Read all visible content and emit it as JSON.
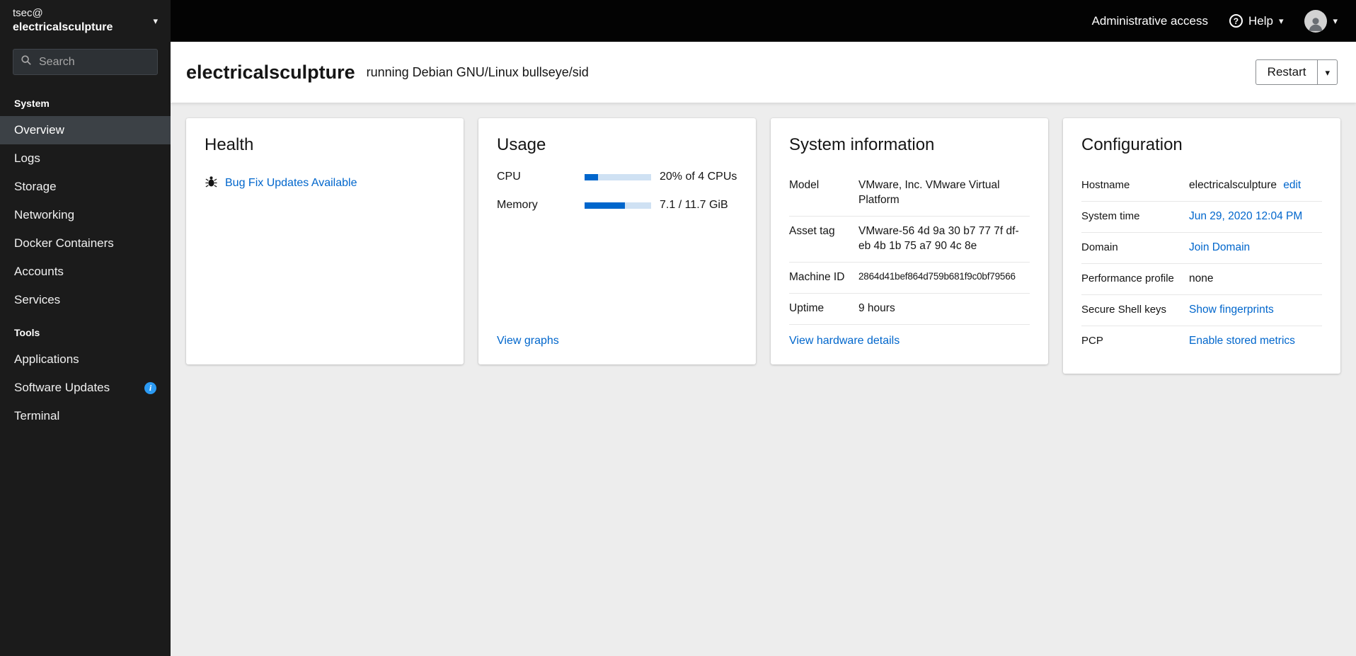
{
  "colors": {
    "accent": "#0066cc",
    "progress_fill": "#0066cc",
    "progress_track": "#cfe1f3",
    "info_badge": "#2b9af3"
  },
  "masthead": {
    "admin_access": "Administrative access",
    "help": "Help"
  },
  "sidebar": {
    "user": "tsec@",
    "host": "electricalsculpture",
    "search": {
      "placeholder": "Search"
    },
    "sections": [
      {
        "label": "System",
        "items": [
          {
            "label": "Overview",
            "active": true
          },
          {
            "label": "Logs"
          },
          {
            "label": "Storage"
          },
          {
            "label": "Networking"
          },
          {
            "label": "Docker Containers"
          },
          {
            "label": "Accounts"
          },
          {
            "label": "Services"
          }
        ]
      },
      {
        "label": "Tools",
        "items": [
          {
            "label": "Applications"
          },
          {
            "label": "Software Updates",
            "badge": "info-icon"
          },
          {
            "label": "Terminal"
          }
        ]
      }
    ]
  },
  "header": {
    "hostname": "electricalsculpture",
    "os": "running Debian GNU/Linux bullseye/sid",
    "restart_label": "Restart"
  },
  "cards": {
    "health": {
      "title": "Health",
      "update_link": "Bug Fix Updates Available"
    },
    "usage": {
      "title": "Usage",
      "rows": [
        {
          "label": "CPU",
          "percent": 20,
          "value": "20% of 4 CPUs"
        },
        {
          "label": "Memory",
          "percent": 61,
          "value": "7.1 / 11.7 GiB"
        }
      ],
      "link": "View graphs"
    },
    "system_info": {
      "title": "System information",
      "rows": [
        {
          "label": "Model",
          "value": "VMware, Inc. VMware Virtual Platform"
        },
        {
          "label": "Asset tag",
          "value": "VMware-56 4d 9a 30 b7 77 7f df-eb 4b 1b 75 a7 90 4c 8e"
        },
        {
          "label": "Machine ID",
          "value": "2864d41bef864d759b681f9c0bf79566"
        },
        {
          "label": "Uptime",
          "value": "9 hours"
        }
      ],
      "link": "View hardware details"
    },
    "configuration": {
      "title": "Configuration",
      "rows": [
        {
          "label": "Hostname",
          "value": "electricalsculpture",
          "link": "edit"
        },
        {
          "label": "System time",
          "link": "Jun 29, 2020 12:04 PM"
        },
        {
          "label": "Domain",
          "link": "Join Domain"
        },
        {
          "label": "Performance profile",
          "value": "none"
        },
        {
          "label": "Secure Shell keys",
          "link": "Show fingerprints"
        },
        {
          "label": "PCP",
          "link": "Enable stored metrics"
        }
      ]
    }
  }
}
